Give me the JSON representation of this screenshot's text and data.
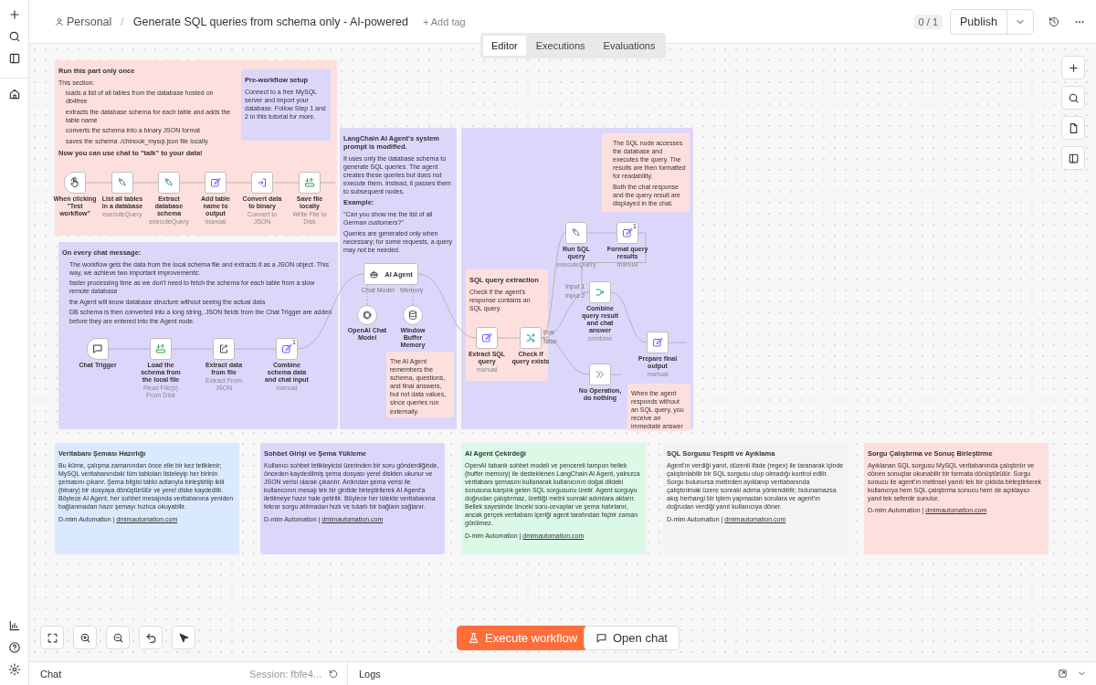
{
  "header": {
    "breadcrumb": "Personal",
    "separator": "/",
    "title": "Generate SQL queries from schema only - AI-powered",
    "add_tag": "+ Add tag",
    "version": "0 / 1",
    "publish": "Publish"
  },
  "tabs": [
    {
      "label": "Editor",
      "selected": true
    },
    {
      "label": "Executions",
      "selected": false
    },
    {
      "label": "Evaluations",
      "selected": false
    }
  ],
  "notes": [
    {
      "color": "#fde0de",
      "items": [
        {
          "kind": "heading",
          "text": "Run this part only once"
        },
        {
          "kind": "text",
          "text": "This section:"
        },
        {
          "kind": "bullet",
          "text": "loads a list of all tables from the database hosted on db4free"
        },
        {
          "kind": "bullet",
          "text": "extracts the database schema for each table and adds the table name"
        },
        {
          "kind": "bullet",
          "text": "converts the schema into a binary JSON format"
        },
        {
          "kind": "bullet",
          "text": "saves the schema ./chinook_mysql.json file locally"
        },
        {
          "kind": "heading",
          "text": "Now you can use chat to \"talk\" to your data!"
        }
      ]
    },
    {
      "color": "#ddd6fb",
      "items": [
        {
          "kind": "heading",
          "text": "Pre-workflow setup"
        },
        {
          "kind": "text",
          "text": "Connect to a free MySQL server and import your database. Follow Step 1 and 2 in this tutorial for more."
        }
      ]
    },
    {
      "color": "#ddd6fb",
      "items": [
        {
          "kind": "heading",
          "text": "On every chat message:"
        },
        {
          "kind": "bullet",
          "text": "The workflow gets the data from the local schema file and extracts it as a JSON object. This way, we achieve two important improvements:"
        },
        {
          "kind": "bullet",
          "text": "faster processing time as we don't need to fetch the schema for each table from a slow remote database"
        },
        {
          "kind": "bullet",
          "text": "the Agent will know database structure without seeing the actual data"
        },
        {
          "kind": "bullet",
          "text": "DB schema is then converted into a long string, JSON fields from the Chat Trigger are added before they are entered into the Agent node."
        }
      ]
    },
    {
      "color": "#ddd6fb",
      "items": [
        {
          "kind": "heading",
          "text": "LangChain AI Agent's system prompt is modified."
        },
        {
          "kind": "text",
          "text": "It uses only the database schema to generate SQL queries. The agent creates these queries but does not execute them. Instead, it passes them to subsequent nodes."
        },
        {
          "kind": "heading",
          "text": "Example:"
        },
        {
          "kind": "text",
          "text": "\"Can you show me the list of all German customers?\""
        },
        {
          "kind": "text",
          "text": "Queries are generated only when necessary; for some requests, a query may not be needed."
        }
      ]
    },
    {
      "color": "#ddd6fb"
    },
    {
      "color": "#fde0de",
      "items": [
        {
          "kind": "heading",
          "text": "SQL query extraction"
        },
        {
          "kind": "text",
          "text": "Check if the agent's response contains an SQL query."
        }
      ]
    },
    {
      "color": "#fde0de",
      "items": [
        {
          "kind": "bullet",
          "text": "The SQL node accesses the database and executes the query. The results are then formatted for readability."
        },
        {
          "kind": "bullet",
          "text": "Both the chat response and the query result are displayed in the chat."
        }
      ]
    },
    {
      "color": "#fde0de",
      "items": [
        {
          "kind": "text",
          "text": "The AI Agent remembers the schema, questions, and final answers, but not data values, since queries run externally."
        }
      ]
    },
    {
      "color": "#fde0de",
      "items": [
        {
          "kind": "text",
          "text": "When the agent responds without an SQL query, you receive an immediate answer"
        }
      ]
    },
    {
      "color": "#dbe9fe",
      "items": [
        {
          "kind": "heading",
          "text": "Veritabanı Şeması Hazırlığı"
        },
        {
          "kind": "text",
          "text": "Bu küme, çalışma zamanından önce elle bir kez tetiklenir; MySQL veritabanındaki tüm tabloları listeleyip her birinin şemasını çıkarır. Şema bilgisi tablo adlarıyla birleştirilip ikili (binary) bir dosyaya dönüştürülür ve yerel diske kaydedilir. Böylece AI Agent, her sohbet mesajında veritabanına yeniden bağlanmadan hazır şemayı hızlıca okuyabilir."
        },
        {
          "kind": "footer",
          "text": "D-mim Automation |",
          "link": "dmimautomation.com"
        }
      ]
    },
    {
      "color": "#ddd6fb",
      "items": [
        {
          "kind": "heading",
          "text": "Sohbet Girişi ve Şema Yükleme"
        },
        {
          "kind": "text",
          "text": "Kullanıcı sohbet tetikleyicisi üzerinden bir soru gönderdiğinde, önceden kaydedilmiş şema dosyası yerel diskten okunur ve JSON verisi olarak çıkarılır. Ardından şema verisi ile kullanıcının mesajı tek bir girdide birleştirilerek AI Agent'a iletilmeye hazır hale getirilir. Böylece her istekte veritabanına tekrar sorgu atılmadan hızlı ve tutarlı bir bağlam sağlanır."
        },
        {
          "kind": "footer",
          "text": "D-mim Automation |",
          "link": "dmimautomation.com"
        }
      ]
    },
    {
      "color": "#dcf8e6",
      "items": [
        {
          "kind": "heading",
          "text": "AI Agent Çekirdeği"
        },
        {
          "kind": "text",
          "text": "OpenAI tabanlı sohbet modeli ve pencereli tampon bellek (buffer memory) ile desteklenen LangChain AI Agent, yalnızca veritabanı şemasını kullanarak kullanıcının doğal dildeki sorusuna karşılık gelen SQL sorgusunu üretir. Agent sorguyu doğrudan çalıştırmaz, ürettiği metni sonraki adımlara aktarır. Bellek sayesinde önceki soru-cevaplar ve şema hatırlanır, ancak gerçek veritabanı içeriği agent tarafından hiçbir zaman görülmez."
        },
        {
          "kind": "footer",
          "text": "D-mim Automation |",
          "link": "dmimautomation.com"
        }
      ]
    },
    {
      "color": "#f3f3f3",
      "items": [
        {
          "kind": "heading",
          "text": "SQL Sorgusu Tespiti ve Ayıklama"
        },
        {
          "kind": "text",
          "text": "Agent'ın verdiği yanıt, düzenli ifade (regex) ile taranarak içinde çalıştırılabilir bir SQL sorgusu olup olmadığı kontrol edilir. Sorgu bulunursa metinden ayıklanıp veritabanında çalıştırılmak üzere sonraki adıma yönlendirilir; bulunamazsa akış herhangi bir işlem yapmadan sorulara ve agent'ın doğrudan verdiği yanıt kullanıcıya döner."
        },
        {
          "kind": "footer",
          "text": "D-mim Automation |",
          "link": "dmimautomation.com"
        }
      ]
    },
    {
      "color": "#fde0de",
      "items": [
        {
          "kind": "heading",
          "text": "Sorgu Çalıştırma ve Sonuç Birleştirme"
        },
        {
          "kind": "text",
          "text": "Ayıklanan SQL sorgusu MySQL veritabanında çalıştırılır ve dönen sonuçlar okunabilir bir formata dönüştürülür. Sorgu sonucu ile agent'ın metinsel yanıtı tek bir çıktıda birleştirilerek kullanıcıya hem SQL çalıştırma sonucu hem de açıklayıcı yanıt tek seferde sunulur."
        },
        {
          "kind": "footer",
          "text": "D-mim Automation |",
          "link": "dmimautomation.com"
        }
      ]
    }
  ],
  "nodes": [
    {
      "kind": "trigger",
      "label": "When clicking \"Test workflow\""
    },
    {
      "kind": "database",
      "label": "List all tables in a database",
      "subtitle": "executeQuery"
    },
    {
      "kind": "database",
      "label": "Extract database schema",
      "subtitle": "executeQuery"
    },
    {
      "kind": "edit",
      "label": "Add table name to output",
      "subtitle": "manual"
    },
    {
      "kind": "convert",
      "label": "Convert data to binary",
      "subtitle": "Convert to JSON"
    },
    {
      "kind": "save",
      "label": "Save file locally",
      "subtitle": "Write File to Disk"
    },
    {
      "kind": "chat",
      "label": "Chat Trigger"
    },
    {
      "kind": "save",
      "label": "Load the schema from the local file",
      "subtitle": "Read File(s) From Disk"
    },
    {
      "kind": "extract",
      "label": "Extract data from file",
      "subtitle": "Extract From JSON"
    },
    {
      "kind": "edit",
      "label": "Combine schema data and chat input",
      "subtitle": "manual",
      "badge": "1"
    },
    {
      "kind": "agent",
      "label": "AI Agent",
      "ports": [
        "Chat Model",
        "Memory"
      ]
    },
    {
      "kind": "model",
      "label": "OpenAI Chat Model"
    },
    {
      "kind": "memory",
      "label": "Window Buffer Memory"
    },
    {
      "kind": "edit",
      "label": "Extract SQL query",
      "subtitle": "manual"
    },
    {
      "kind": "branch",
      "label": "Check if query exists",
      "ports": [
        "true",
        "false"
      ]
    },
    {
      "kind": "database",
      "label": "Run SQL query",
      "subtitle": "executeQuery"
    },
    {
      "kind": "edit",
      "label": "Format query results",
      "subtitle": "manual",
      "badge": "1"
    },
    {
      "kind": "merge",
      "label": "Combine query result and chat answer",
      "subtitle": "combine",
      "ports": [
        "Input 1",
        "Input 2"
      ]
    },
    {
      "kind": "edit",
      "label": "Prepare final output",
      "subtitle": "manual"
    },
    {
      "kind": "noop",
      "label": "No Operation, do nothing"
    }
  ],
  "actions": {
    "execute": "Execute workflow",
    "open_chat": "Open chat"
  },
  "bottom_panel": {
    "chat": "Chat",
    "session": "Session: fbfe4...",
    "logs": "Logs"
  }
}
